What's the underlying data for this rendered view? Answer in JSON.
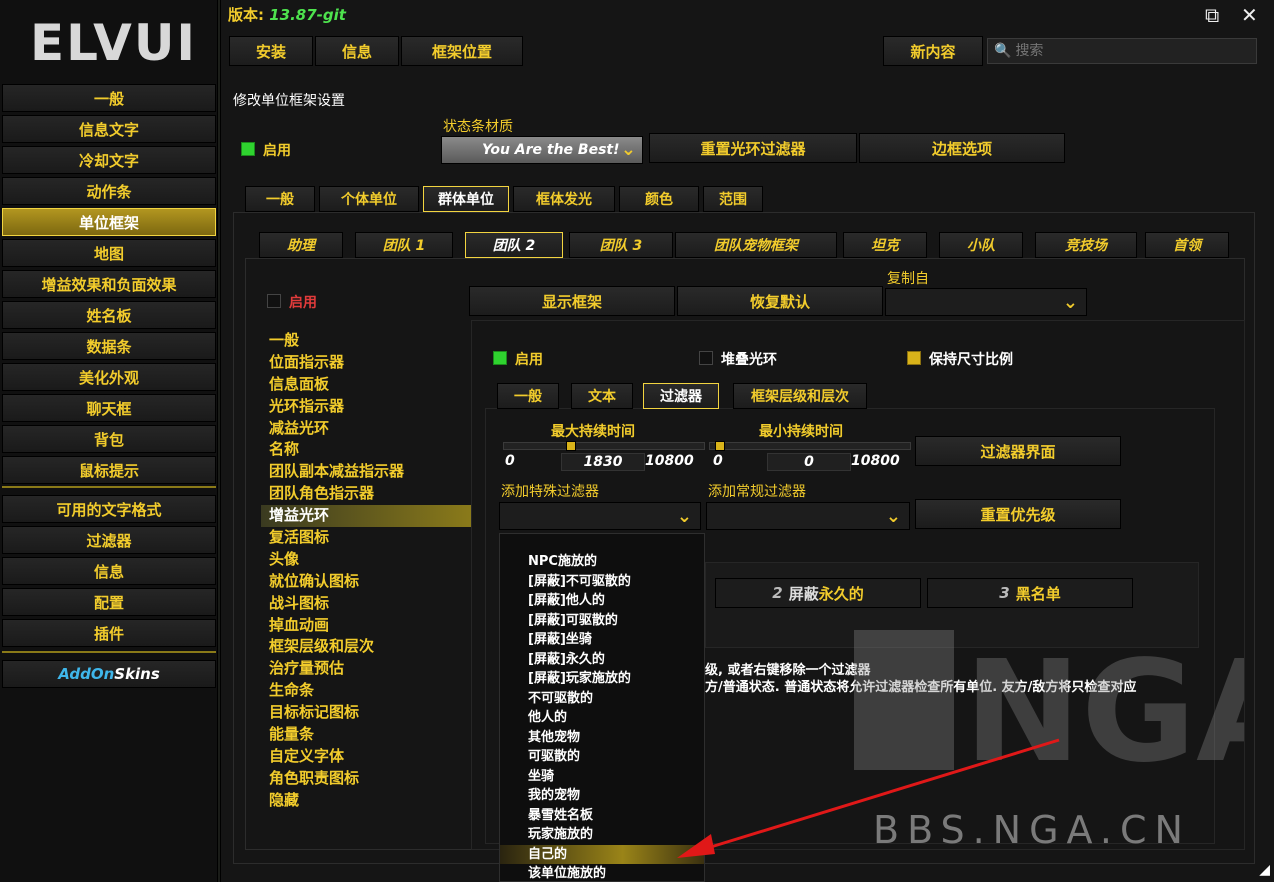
{
  "sidebar": {
    "logo": "ELVUI",
    "items": [
      "一般",
      "信息文字",
      "冷却文字",
      "动作条",
      "单位框架",
      "地图",
      "增益效果和负面效果",
      "姓名板",
      "数据条",
      "美化外观",
      "聊天框",
      "背包",
      "鼠标提示"
    ],
    "active": "单位框架",
    "items2": [
      "可用的文字格式",
      "过滤器",
      "信息",
      "配置",
      "插件"
    ],
    "addon_a": "AddOn",
    "addon_b": "Skins"
  },
  "header": {
    "version_label": "版本: ",
    "version_value": "13.87-git",
    "maximize_icon": "⧉",
    "close_icon": "✕",
    "tabs": [
      "安装",
      "信息",
      "框架位置"
    ],
    "new_content": "新内容",
    "search_placeholder": "搜索"
  },
  "content": {
    "title": "修改单位框架设置",
    "enable": "启用",
    "statusbar_label": "状态条材质",
    "statusbar_value": "You Are the Best!",
    "reset_aura_filter": "重置光环过滤器",
    "border_options": "边框选项",
    "main_tabs": [
      "一般",
      "个体单位",
      "群体单位",
      "框体发光",
      "颜色",
      "范围"
    ],
    "main_tab_selected": "群体单位",
    "group_tabs": [
      "助理",
      "团队 1",
      "团队 2",
      "团队 3",
      "团队宠物框架",
      "坦克",
      "小队",
      "竞技场",
      "首领"
    ],
    "group_tab_selected": "团队 2",
    "enable2": "启用",
    "show_frames": "显示框架",
    "restore_defaults": "恢复默认",
    "copy_from": "复制自",
    "sub_items": [
      "一般",
      "位面指示器",
      "信息面板",
      "光环指示器",
      "减益光环",
      "名称",
      "团队副本减益指示器",
      "团队角色指示器",
      "增益光环",
      "复活图标",
      "头像",
      "就位确认图标",
      "战斗图标",
      "掉血动画",
      "框架层级和层次",
      "治疗量预估",
      "生命条",
      "目标标记图标",
      "能量条",
      "自定义字体",
      "角色职责图标",
      "隐藏"
    ],
    "sub_selected": "增益光环",
    "buffs": {
      "enable": "启用",
      "stack_auras": "堆叠光环",
      "keep_size_ratio": "保持尺寸比例",
      "tabs": [
        "一般",
        "文本",
        "过滤器",
        "框架层级和层次"
      ],
      "tab_selected": "过滤器",
      "max_duration_label": "最大持续时间",
      "max_min": "0",
      "max_value": "1830",
      "max_max": "10800",
      "max_fraction": 0.169,
      "min_duration_label": "最小持续时间",
      "min_min": "0",
      "min_value": "0",
      "min_max": "10800",
      "min_fraction": 0.0,
      "filter_ui": "过滤器界面",
      "add_special_filter": "添加特殊过滤器",
      "add_regular_filter": "添加常规过滤器",
      "reset_priority": "重置优先级",
      "priority": [
        {
          "n": "2",
          "pre": "屏蔽",
          "word": "永久的"
        },
        {
          "n": "3",
          "pre": "",
          "word": "黑名单"
        }
      ],
      "info_line1": "级, 或者右键移除一个过滤器",
      "info_line2": "方/普通状态. 普通状态将允许过滤器检查所有单位. 友方/敌方将只检查对应"
    },
    "filter_options": [
      "NPC施放的",
      "[屏蔽]不可驱散的",
      "[屏蔽]他人的",
      "[屏蔽]可驱散的",
      "[屏蔽]坐骑",
      "[屏蔽]永久的",
      "[屏蔽]玩家施放的",
      "不可驱散的",
      "他人的",
      "其他宠物",
      "可驱散的",
      "坐骑",
      "我的宠物",
      "暴雪姓名板",
      "玩家施放的",
      "自己的",
      "该单位施放的"
    ],
    "filter_highlight": "自己的"
  },
  "watermark": {
    "logo": "NGA",
    "url": "BBS.NGA.CN"
  },
  "colors": {
    "gold": "#f2cc2c",
    "green_version": "#4ee34e",
    "green_check": "#2fd32f",
    "addon_blue": "#3fb6ea"
  }
}
